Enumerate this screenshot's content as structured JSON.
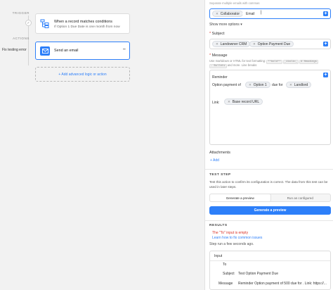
{
  "canvas": {
    "trigger_label": "TRIGGER",
    "actions_label": "ACTIONS",
    "trigger": {
      "title": "When a record matches conditions",
      "subtitle": "If Option 1 Due Date is one month from now"
    },
    "action": {
      "fix_label": "Fix testing error",
      "title": "Send an email",
      "menu_glyph": "•••"
    },
    "add_logic": "+ Add advanced logic or action",
    "check_glyph": "✓"
  },
  "panel": {
    "to_hint": "Separate multiple emails with commas",
    "to_field": {
      "pills": [
        {
          "label": "Collaborator"
        },
        {
          "label": "Email"
        }
      ],
      "cursor": "|"
    },
    "show_more": "Show more options",
    "show_more_chevron": "▾",
    "subject": {
      "label": "Subject",
      "required_mark": "*",
      "pills": [
        {
          "label": "Landowner CRM"
        },
        {
          "label": "Option Payment Due"
        }
      ]
    },
    "message": {
      "label": "Message",
      "required_mark": "*",
      "format_hint_1": "Use markdown or HTML for text formatting:",
      "format_tags_1": [
        "**bold**",
        "_italic_",
        "# Headings"
      ],
      "format_hint_2": "",
      "format_tags_2": [
        "- Bullets"
      ],
      "format_hint_2_end": "and more. Line breaks",
      "line1": "Reminder",
      "line2_prefix": "Option payment of",
      "line2_pill": "Option 1",
      "line2_mid": "due for",
      "line2_pill2": "Landlord",
      "line3_prefix": "Link:",
      "line3_pill": "Base record URL"
    },
    "attachments": {
      "label": "Attachments",
      "add": "+ Add"
    },
    "test_step": {
      "heading": "TEST STEP",
      "description": "Test this action to confirm its configuration is correct. The data from this test can be used in later steps.",
      "tabs": [
        "Generate a preview",
        "Run as configured"
      ],
      "active_tab": 0,
      "button": "Generate a preview"
    },
    "results": {
      "heading": "RESULTS",
      "error": "The \"To\" input is empty",
      "help_link": "Learn how to fix common issues",
      "run_info": "Step run a few seconds ago.",
      "input_label": "Input",
      "rows": [
        {
          "key": "To",
          "value": ""
        },
        {
          "key": "Subject",
          "value": "Test Option Payment Due"
        },
        {
          "key": "Message",
          "value": "Reminder Option payment of 500 due for . Link: https://..."
        }
      ]
    }
  },
  "colors": {
    "accent": "#2d7ff9",
    "error": "#d93025"
  },
  "icons": {
    "trigger": "record-conditions-icon",
    "action": "email-envelope-icon",
    "close_pill": "close-icon",
    "add": "plus-icon"
  }
}
